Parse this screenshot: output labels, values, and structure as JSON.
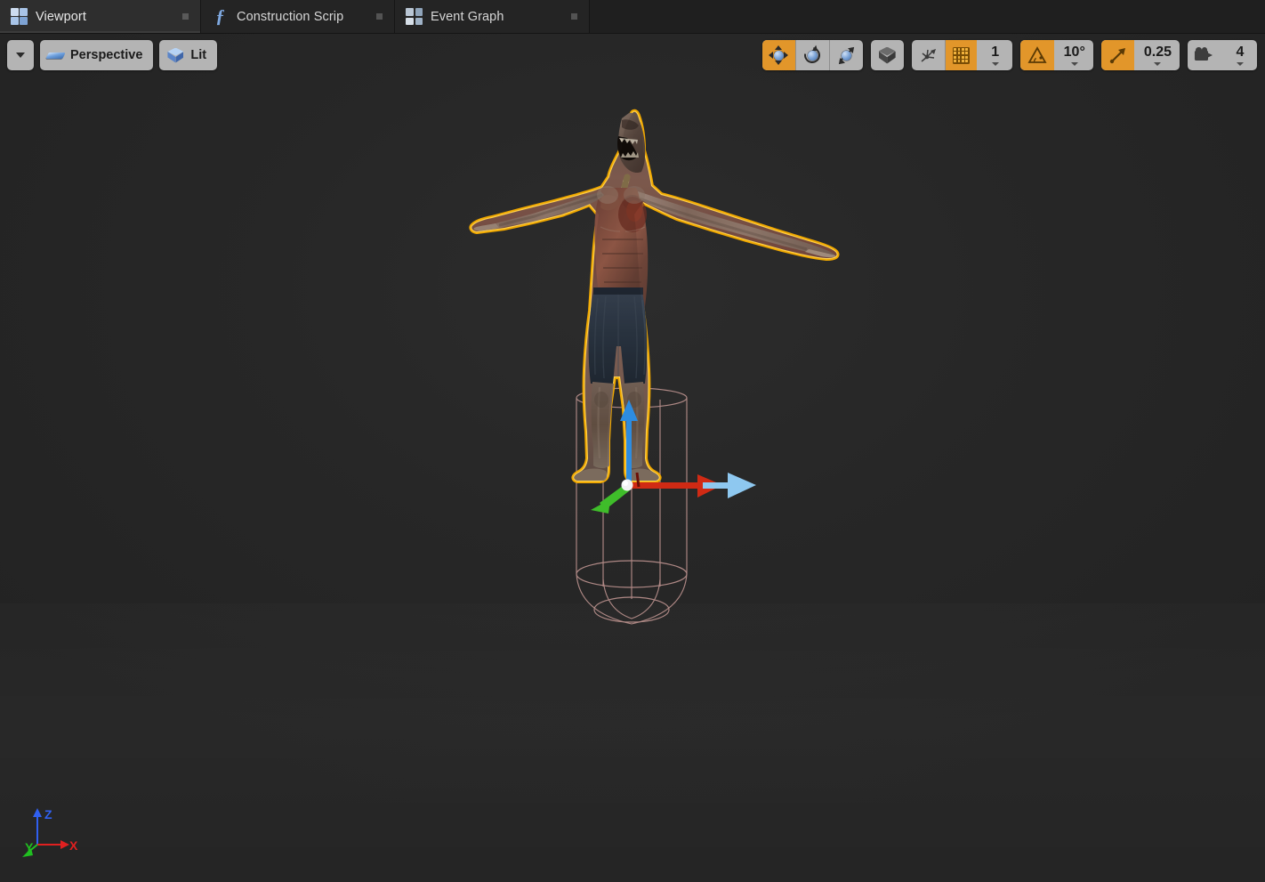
{
  "window": {
    "title": "Unreal Engine Blueprint Editor — Viewport"
  },
  "tabs": [
    {
      "label": "Viewport",
      "icon": "viewport-grid-icon",
      "active": true,
      "closeable": true
    },
    {
      "label": "Construction Scrip",
      "icon": "function-fx-icon",
      "active": false,
      "closeable": true
    },
    {
      "label": "Event Graph",
      "icon": "event-graph-icon",
      "active": false,
      "closeable": true
    }
  ],
  "toolbar": {
    "left": {
      "menu_caret": "caret-down-icon",
      "view_mode": {
        "label": "Perspective",
        "icon": "perspective-slab-icon"
      },
      "shading_mode": {
        "label": "Lit",
        "icon": "lit-cube-icon"
      }
    },
    "right": {
      "transform_modes": [
        {
          "name": "translate",
          "icon": "translate-gizmo-icon",
          "active": true
        },
        {
          "name": "rotate",
          "icon": "rotate-gizmo-icon",
          "active": false
        },
        {
          "name": "scale",
          "icon": "scale-gizmo-icon",
          "active": false
        }
      ],
      "coordinate_system": {
        "name": "world-space",
        "icon": "world-cube-icon",
        "active": false
      },
      "surface_snap": {
        "name": "surface-snap",
        "icon": "surface-snap-icon",
        "active": false
      },
      "grid_snap": {
        "name": "grid-snap",
        "icon": "grid-snap-icon",
        "active": true,
        "value": "1"
      },
      "angle_snap": {
        "name": "angle-snap",
        "icon": "angle-snap-icon",
        "active": true,
        "value": "10°"
      },
      "scale_snap": {
        "name": "scale-snap",
        "icon": "scale-snap-icon",
        "active": true,
        "value": "0.25"
      },
      "camera_speed": {
        "name": "camera-speed",
        "icon": "movie-camera-icon",
        "active": false,
        "value": "4"
      }
    }
  },
  "viewport": {
    "background_color": "#262626",
    "selection_outline_color": "#f0a800",
    "capsule_color": "#c79a96",
    "selected_actor": "skeletal-mesh-character",
    "gizmo": {
      "type": "translate",
      "axis_x_color": "#d02a14",
      "axis_y_color": "#3fbd2a",
      "axis_z_color": "#2d8ce0",
      "highlighted_axis": "X",
      "highlight_color": "#8ec8f0"
    },
    "axis_indicator": {
      "x": {
        "label": "X",
        "color": "#e02020"
      },
      "y": {
        "label": "Y",
        "color": "#20c020"
      },
      "z": {
        "label": "Z",
        "color": "#3060f0"
      }
    }
  }
}
